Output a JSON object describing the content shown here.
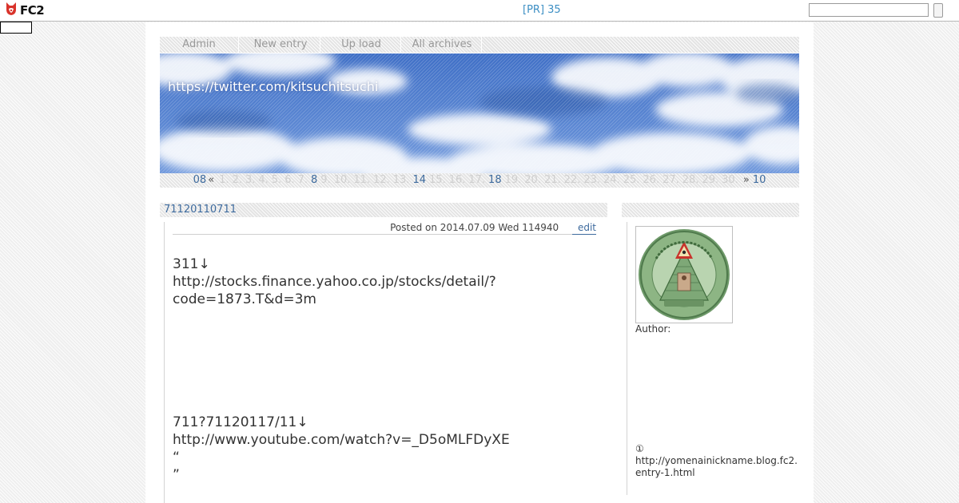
{
  "topbar": {
    "logo_text": "FC2",
    "pr_link": "[PR] 35",
    "search_placeholder": ""
  },
  "admin_nav": [
    {
      "label": "Admin"
    },
    {
      "label": "New entry"
    },
    {
      "label": "Up load"
    },
    {
      "label": "All archives"
    }
  ],
  "header": {
    "blog_title": "https://twitter.com/kitsuchitsuchi"
  },
  "calendar": {
    "prev_month": "08",
    "prev_arrow": "«",
    "next_arrow": "»",
    "next_month": "10",
    "days": [
      "1.",
      "2.",
      "3.",
      "4.",
      "5.",
      "6.",
      "7.",
      "8",
      "9.",
      "10.",
      "11.",
      "12.",
      "13.",
      "14",
      "15.",
      "16.",
      "17.",
      "18",
      "19.",
      "20.",
      "21.",
      "22.",
      "23.",
      "24.",
      "25.",
      "26.",
      "27.",
      "28.",
      "29.",
      "30."
    ],
    "linked_days": [
      "8",
      "14",
      "18"
    ]
  },
  "entry": {
    "title": "71120110711",
    "posted": "Posted on 2014.07.09 Wed 114940",
    "edit_label": "edit",
    "paragraph1": "311↓\nhttp://stocks.finance.yahoo.co.jp/stocks/detail/?\ncode=1873.T&d=3m",
    "paragraph2": "711?71120117/11↓\nhttp://www.youtube.com/watch?v=_D5oMLFDyXE\n“\n”"
  },
  "sidebar": {
    "author_label": "Author:",
    "note_line1": "①",
    "note_line2": "http://yomenainickname.blog.fc2.",
    "note_line3": "entry-1.html"
  },
  "colors": {
    "link": "#3e6b9e",
    "pr_link": "#3d8fc4",
    "sky": "#4f7dd0"
  }
}
